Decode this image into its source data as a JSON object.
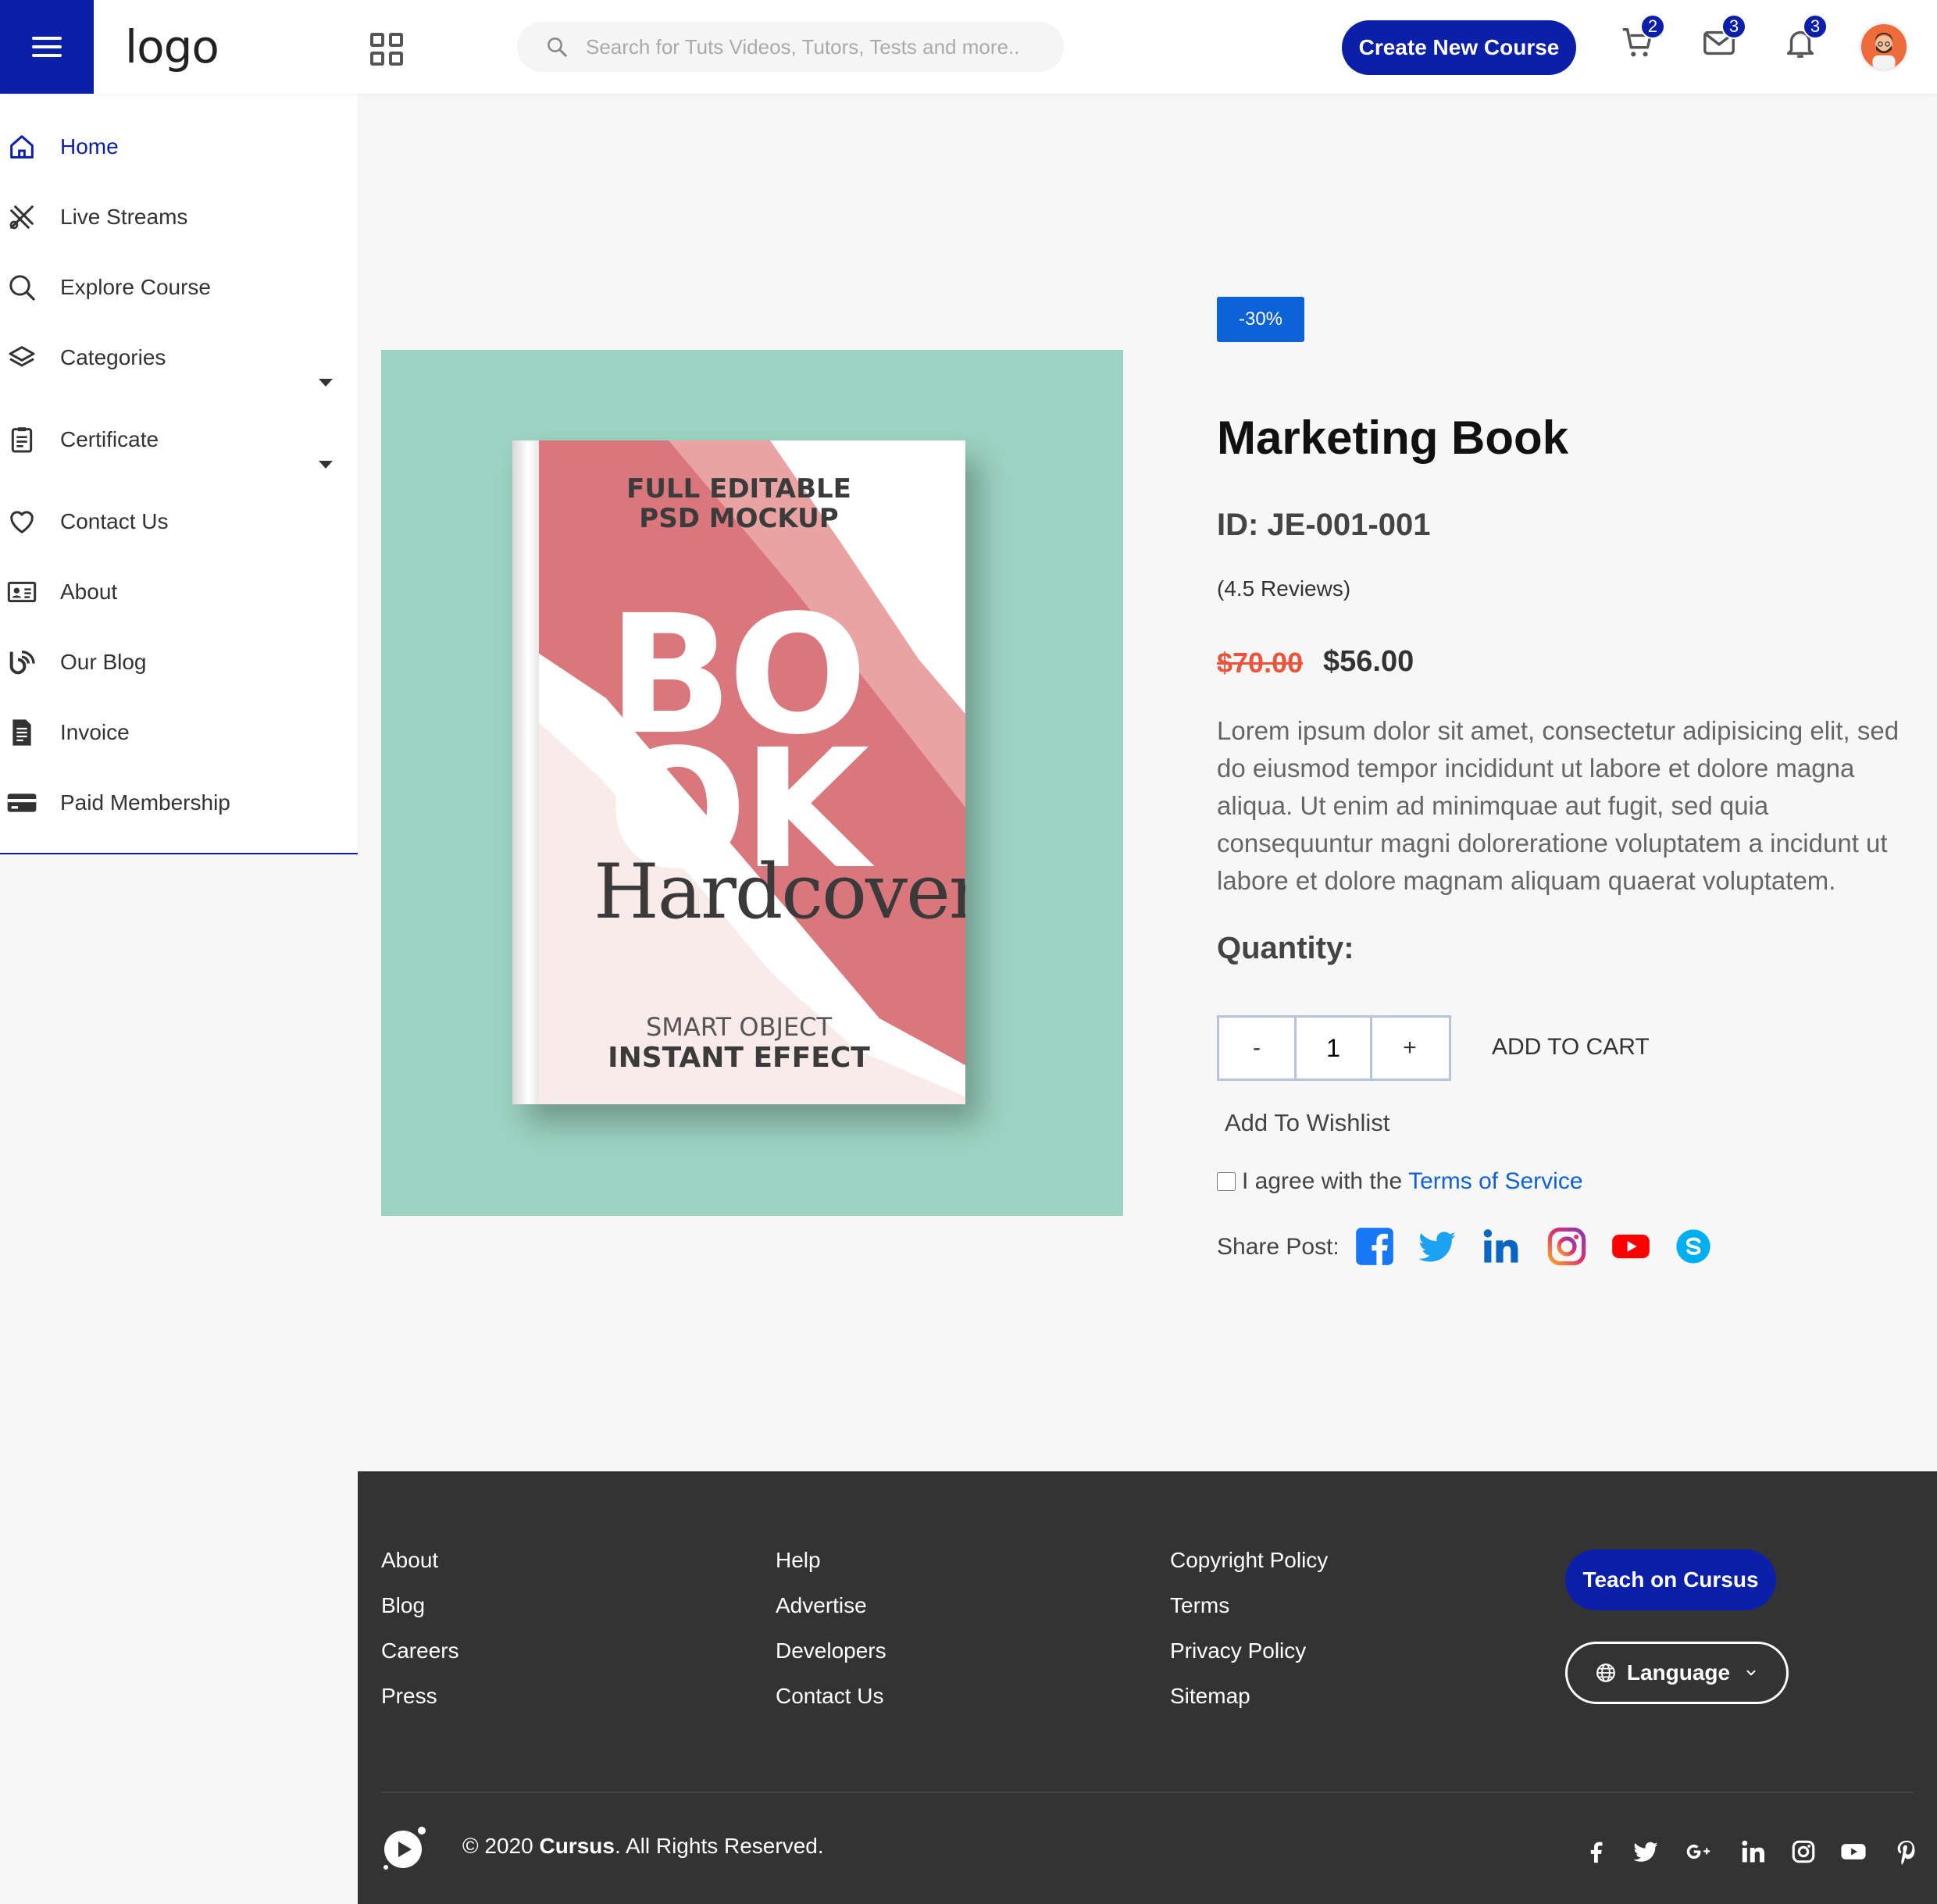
{
  "header": {
    "logo": "logo",
    "search_placeholder": "Search for Tuts Videos, Tutors, Tests and more..",
    "create_course_label": "Create New Course",
    "cart_count": "2",
    "messages_count": "3",
    "notifications_count": "3"
  },
  "sidebar": {
    "items": [
      {
        "label": "Home",
        "icon": "home-icon"
      },
      {
        "label": "Live Streams",
        "icon": "live-streams-icon"
      },
      {
        "label": "Explore Course",
        "icon": "search-icon"
      },
      {
        "label": "Categories",
        "icon": "layers-icon"
      },
      {
        "label": "Certificate",
        "icon": "clipboard-icon"
      },
      {
        "label": "Contact Us",
        "icon": "heart-icon"
      },
      {
        "label": "About",
        "icon": "id-card-icon"
      },
      {
        "label": "Our Blog",
        "icon": "blog-icon"
      },
      {
        "label": "Invoice",
        "icon": "invoice-icon"
      },
      {
        "label": "Paid Membership",
        "icon": "credit-card-icon"
      }
    ]
  },
  "product": {
    "discount": "-30%",
    "title": "Marketing Book",
    "id": "ID: JE-001-001",
    "reviews": "(4.5 Reviews)",
    "old_price": "$70.00",
    "new_price": "$56.00",
    "description": "Lorem ipsum dolor sit amet, consectetur adipisicing elit, sed do eiusmod tempor incididunt ut labore et dolore magna aliqua. Ut enim ad minimquae aut fugit, sed quia consequuntur magni doloreratione voluptatem a incidunt ut labore et dolore magnam aliquam quaerat voluptatem.",
    "quantity_label": "Quantity:",
    "minus": "-",
    "plus": "+",
    "quantity_value": "1",
    "add_to_cart": "ADD TO CART",
    "add_to_wishlist": "Add To Wishlist",
    "agree_text": "I agree with the",
    "terms_link": "Terms of Service",
    "share_label": "Share Post:",
    "book_cover": {
      "line1": "FULL EDITABLE",
      "line2": "PSD MOCKUP",
      "big1": "BO",
      "big2": "OK",
      "hardcover": "Hardcover",
      "line3": "SMART OBJECT",
      "line4": "INSTANT EFFECT"
    }
  },
  "footer": {
    "col1": [
      "About",
      "Blog",
      "Careers",
      "Press"
    ],
    "col2": [
      "Help",
      "Advertise",
      "Developers",
      "Contact Us"
    ],
    "col3": [
      "Copyright Policy",
      "Terms",
      "Privacy Policy",
      "Sitemap"
    ],
    "teach_label": "Teach on Cursus",
    "language_label": "Language",
    "copyright_prefix": "© 2020",
    "copyright_brand": "Cursus",
    "copyright_suffix": ". All Rights Reserved."
  },
  "colors": {
    "primary": "#0b1fa8",
    "accent_blue": "#0e62d8",
    "old_price": "#e8553a",
    "footer_bg": "#333333",
    "book_bg": "#9cd3c2"
  }
}
